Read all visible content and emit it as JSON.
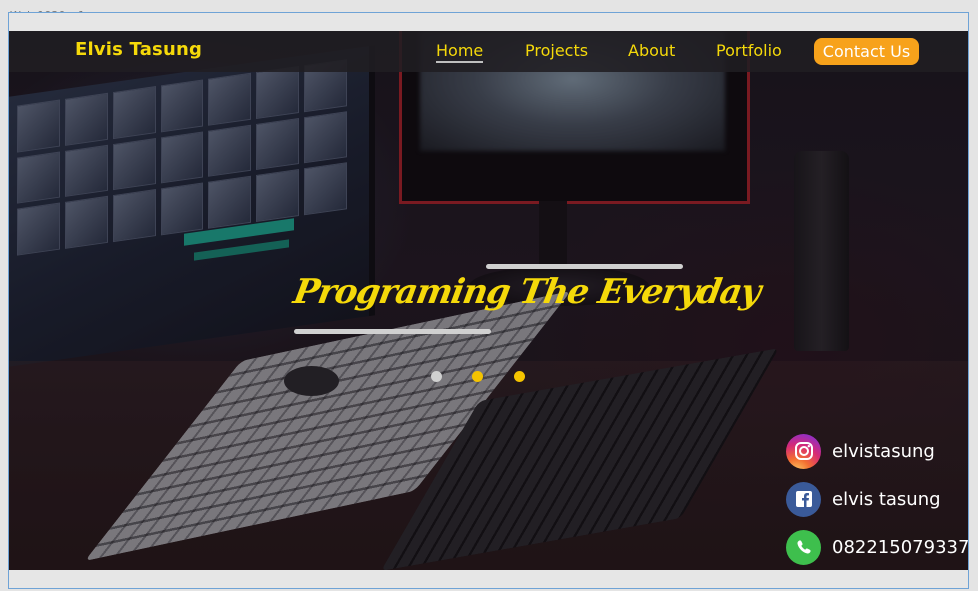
{
  "artboard": {
    "label": "Web 1920 – 1"
  },
  "navbar": {
    "brand": "Elvis Tasung",
    "links": [
      "Home",
      "Projects",
      "About",
      "Portfolio"
    ],
    "active_link": "Home",
    "contact_button": "Contact Us"
  },
  "hero": {
    "headline": "Programing The Everyday",
    "carousel": {
      "dot_count": 3,
      "active_index": 0
    }
  },
  "social": {
    "instagram": {
      "icon": "instagram-icon",
      "text": "elvistasung"
    },
    "facebook": {
      "icon": "facebook-icon",
      "text": "elvis tasung"
    },
    "whatsapp": {
      "icon": "whatsapp-icon",
      "text": "082215079337"
    }
  },
  "colors": {
    "accent_yellow": "#f5d90a",
    "button_orange": "#f7a21b",
    "navbar_bg": "#201e22",
    "dot_inactive": "#d0d0d0",
    "dot_active": "#f5c400"
  }
}
